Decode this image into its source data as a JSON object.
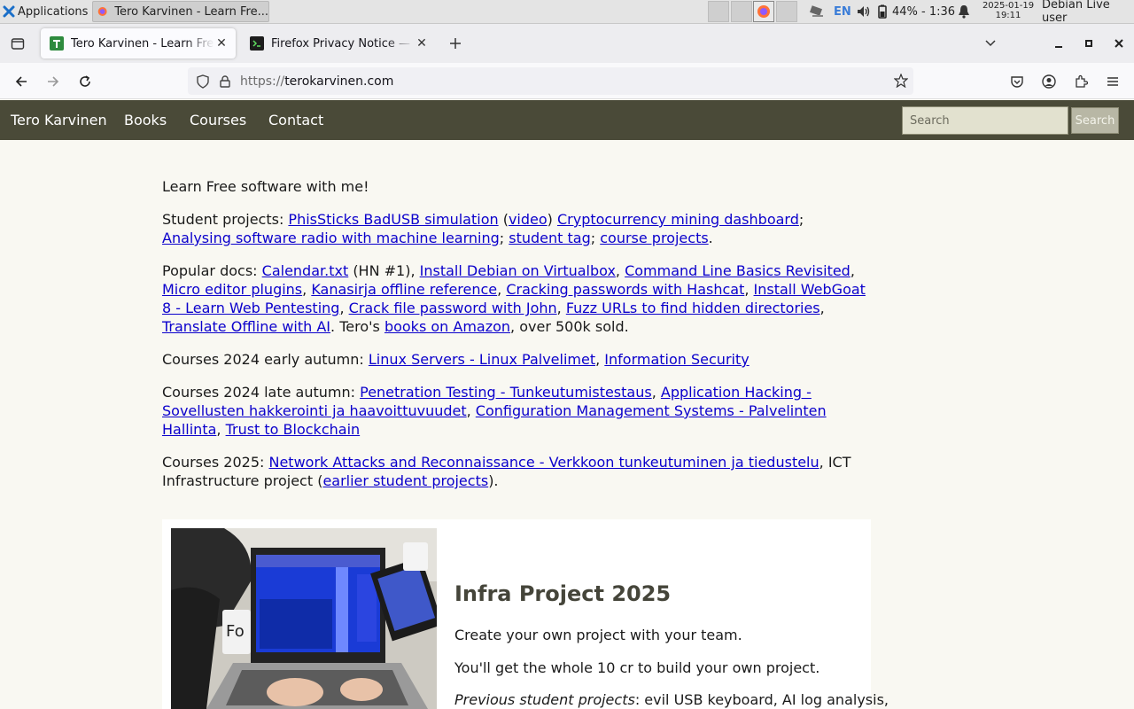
{
  "taskbar": {
    "apps_label": "Applications",
    "task_title": "Tero Karvinen - Learn Fre...",
    "lang": "EN",
    "battery": "44% - 1:36",
    "date": "2025-01-19",
    "time": "19:11",
    "user": "Debian Live user"
  },
  "browser": {
    "tabs": [
      {
        "title": "Tero Karvinen - Learn Free"
      },
      {
        "title": "Firefox Privacy Notice — M"
      }
    ],
    "url_proto": "https://",
    "url_host": "terokarvinen.com"
  },
  "site": {
    "nav": [
      "Tero Karvinen",
      "Books",
      "Courses",
      "Contact"
    ],
    "search_placeholder": "Search",
    "search_button": "Search"
  },
  "content": {
    "intro": "Learn Free software with me!",
    "student_label": "Student projects:",
    "student_links": [
      "PhisSticks BadUSB simulation",
      "video",
      "Cryptocurrency mining dashboard",
      "Analysing software radio with machine learning",
      "student tag",
      "course projects"
    ],
    "popular_label": "Popular docs:",
    "popular_links": [
      "Calendar.txt",
      "Install Debian on Virtualbox",
      "Command Line Basics Revisited",
      "Micro editor plugins",
      "Kanasirja offline reference",
      "Cracking passwords with Hashcat",
      "Install WebGoat 8 - Learn Web Pentesting",
      "Crack file password with John",
      "Fuzz URLs to find hidden directories",
      "Translate Offline with AI"
    ],
    "popular_hn": "(HN #1),",
    "popular_tero": ". Tero's",
    "popular_books": "books on Amazon",
    "popular_sold": ", over 500k sold.",
    "early_label": "Courses 2024 early autumn:",
    "early_links": [
      "Linux Servers - Linux Palvelimet",
      "Information Security"
    ],
    "late_label": "Courses 2024 late autumn:",
    "late_links": [
      "Penetration Testing - Tunkeutumistestaus",
      "Application Hacking - Sovellusten hakkerointi ja haavoittuvuudet",
      "Configuration Management Systems - Palvelinten Hallinta",
      "Trust to Blockchain"
    ],
    "y2025_label": "Courses 2025:",
    "y2025_link": "Network Attacks and Reconnaissance - Verkkoon tunkeutuminen ja tiedustelu",
    "y2025_ict": ", ICT Infrastructure project (",
    "y2025_earlier": "earlier student projects",
    "y2025_end": ")."
  },
  "card": {
    "title": "Infra Project 2025",
    "line1": "Create your own project with your team.",
    "line2": "You'll get the whole 10 cr to build your own project.",
    "prev_label": "Previous student projects",
    "prev_text": ": evil USB keyboard, AI log analysis,"
  }
}
